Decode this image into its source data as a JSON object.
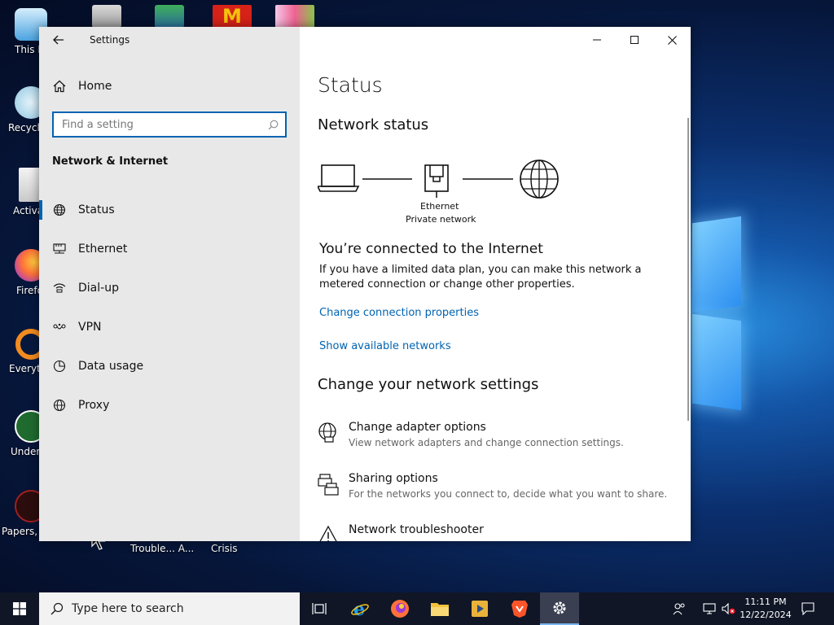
{
  "desktop": {
    "icons": [
      {
        "label": "This P"
      },
      {
        "label": "Recycle"
      },
      {
        "label": "Activa"
      },
      {
        "label": "Firefo"
      },
      {
        "label": "Everyth"
      },
      {
        "label": "Undert"
      },
      {
        "label": "Papers, P"
      }
    ],
    "bottom_labels": [
      "Trouble... A...",
      "Crisis"
    ]
  },
  "window": {
    "title": "Settings",
    "search_placeholder": "Find a setting",
    "home_label": "Home",
    "section_title": "Network & Internet",
    "nav": [
      {
        "label": "Status",
        "icon": "globe-icon",
        "selected": true
      },
      {
        "label": "Ethernet",
        "icon": "ethernet-icon",
        "selected": false
      },
      {
        "label": "Dial-up",
        "icon": "dialup-icon",
        "selected": false
      },
      {
        "label": "VPN",
        "icon": "vpn-icon",
        "selected": false
      },
      {
        "label": "Data usage",
        "icon": "data-usage-icon",
        "selected": false
      },
      {
        "label": "Proxy",
        "icon": "globe-icon",
        "selected": false
      }
    ]
  },
  "content": {
    "page_title": "Status",
    "network_status_heading": "Network status",
    "adapter_name": "Ethernet",
    "network_profile": "Private network",
    "connected_heading": "You’re connected to the Internet",
    "connected_body": "If you have a limited data plan, you can make this network a metered connection or change other properties.",
    "change_properties_link": "Change connection properties",
    "show_networks_link": "Show available networks",
    "change_settings_heading": "Change your network settings",
    "options": [
      {
        "title": "Change adapter options",
        "desc": "View network adapters and change connection settings.",
        "icon": "adapter-globe-icon"
      },
      {
        "title": "Sharing options",
        "desc": "For the networks you connect to, decide what you want to share.",
        "icon": "sharing-icon"
      },
      {
        "title": "Network troubleshooter",
        "desc": "",
        "icon": "warning-icon"
      }
    ]
  },
  "taskbar": {
    "search_text": "Type here to search",
    "time": "11:11 PM",
    "date": "12/22/2024",
    "accent": "#0063b1"
  }
}
